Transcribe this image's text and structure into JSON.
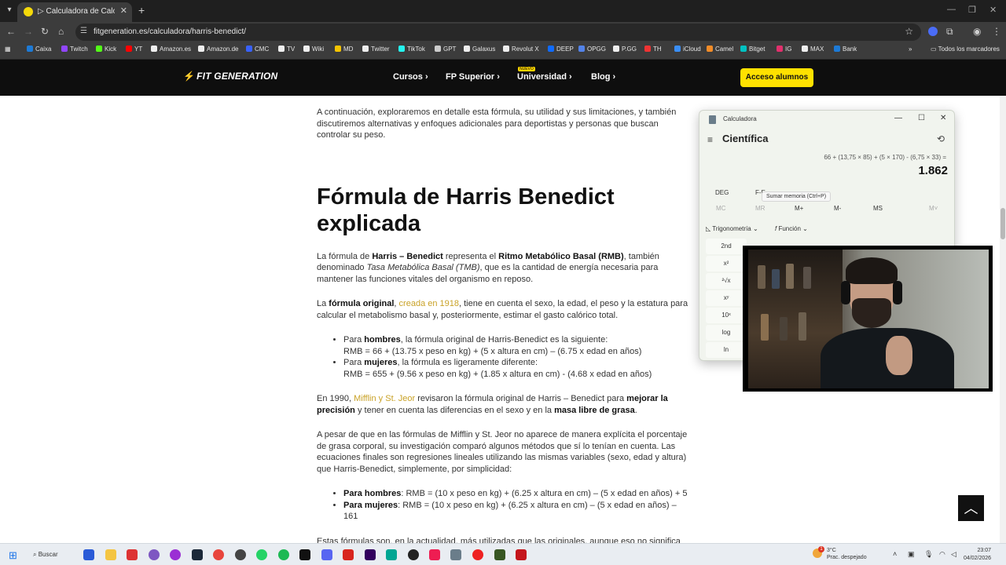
{
  "browser": {
    "tab_title": "▷ Calculadora de Calorías Harr",
    "url": "fitgeneration.es/calculadora/harris-benedict/",
    "bookmarks": [
      {
        "label": "Caixa",
        "color": "#1d7ad6"
      },
      {
        "label": "Twitch",
        "color": "#9146ff"
      },
      {
        "label": "Kick",
        "color": "#53fc18"
      },
      {
        "label": "YT",
        "color": "#ff0000"
      },
      {
        "label": "Amazon.es",
        "color": "#eeeeee"
      },
      {
        "label": "Amazon.de",
        "color": "#eeeeee"
      },
      {
        "label": "CMC",
        "color": "#3861fb"
      },
      {
        "label": "TV",
        "color": "#eeeeee"
      },
      {
        "label": "Wiki",
        "color": "#eeeeee"
      },
      {
        "label": "MD",
        "color": "#f5c400"
      },
      {
        "label": "Twitter",
        "color": "#eeeeee"
      },
      {
        "label": "TikTok",
        "color": "#25f4ee"
      },
      {
        "label": "GPT",
        "color": "#cccccc"
      },
      {
        "label": "Galaxus",
        "color": "#eeeeee"
      },
      {
        "label": "Revolut X",
        "color": "#eeeeee"
      },
      {
        "label": "DEEP",
        "color": "#0f6bff"
      },
      {
        "label": "OPGG",
        "color": "#5383e8"
      },
      {
        "label": "P.GG",
        "color": "#eeeeee"
      },
      {
        "label": "TH",
        "color": "#e33"
      },
      {
        "label": "iCloud",
        "color": "#3a8ef6"
      },
      {
        "label": "Camel",
        "color": "#f28c28"
      },
      {
        "label": "Bitget",
        "color": "#00c1c1"
      },
      {
        "label": "IG",
        "color": "#e1306c"
      },
      {
        "label": "MAX",
        "color": "#eeeeee"
      },
      {
        "label": "Bank",
        "color": "#1d7ad6"
      }
    ],
    "all_bookmarks": "Todos los marcadores"
  },
  "site": {
    "logo": "FIT GENERATION",
    "nav": [
      "Cursos",
      "FP Superior",
      "Universidad",
      "Blog"
    ],
    "nav_badge": "NUEVO",
    "cta": "Acceso alumnos"
  },
  "article": {
    "intro": "A continuación, exploraremos en detalle esta fórmula, su utilidad y sus limitaciones, y también discutiremos alternativas y enfoques adicionales para deportistas y personas que buscan controlar su peso.",
    "heading": "Fórmula de Harris Benedict explicada",
    "p1": {
      "a": "La fórmula de ",
      "b1": "Harris – Benedict",
      "c": " representa el ",
      "b2": "Ritmo Metabólico Basal (RMB)",
      "d": ", también denominado ",
      "i1": "Tasa Metabólica Basal (TMB)",
      "e": ", que es la cantidad de energía necesaria para mantener las funciones vitales del organismo en reposo."
    },
    "p2": {
      "a": "La ",
      "b1": "fórmula original",
      "c": ", ",
      "link": "creada en 1918",
      "d": ", tiene en cuenta el sexo, la edad, el peso y la estatura para calcular el metabolismo basal y, posteriormente, estimar el gasto calórico total."
    },
    "list1": [
      {
        "pre": "Para ",
        "bold": "hombres",
        "post": ", la fórmula original de Harris-Benedict es la siguiente:",
        "formula": "RMB = 66 + (13.75 x peso en kg) + (5 x altura en cm) – (6.75 x edad en años)"
      },
      {
        "pre": "Para ",
        "bold": "mujeres",
        "post": ", la fórmula es ligeramente diferente:",
        "formula": "RMB = 655 + (9.56 x peso en kg) + (1.85 x altura en cm) - (4.68 x edad en años)"
      }
    ],
    "p3": {
      "a": "En 1990, ",
      "link": "Mifflin y St. Jeor",
      "b": " revisaron la fórmula original de Harris – Benedict para ",
      "b1": "mejorar la precisión",
      "c": " y tener en cuenta las diferencias en el sexo y en la ",
      "b2": "masa libre de grasa",
      "d": "."
    },
    "p4": "A pesar de que en las fórmulas de Mifflin y St. Jeor no aparece de manera explícita el porcentaje de grasa corporal, su investigación comparó algunos métodos que sí lo tenían en cuenta. Las ecuaciones finales son regresiones lineales utilizando las mismas variables (sexo, edad y altura) que Harris-Benedict, simplemente, por simplicidad:",
    "list2": [
      {
        "bold": "Para hombres",
        "text": ": RMB = (10 x peso en kg) + (6.25 x altura en cm) – (5 x edad en años) + 5"
      },
      {
        "bold": "Para mujeres",
        "text": ": RMB = (10 x peso en kg) + (6.25 x altura en cm) – (5 x edad en años) – 161"
      }
    ],
    "p5": "Estas fórmulas son, en la actualidad, más utilizadas que las originales, aunque eso no significa"
  },
  "calculator": {
    "title": "Calculadora",
    "mode": "Científica",
    "expression": "66 + (13,75 × 85) + (5 × 170) - (6,75 × 33) =",
    "result": "1.862",
    "angle": "DEG",
    "fe": "F-E",
    "tooltip": "Sumar memoria (Ctrl+P)",
    "memory": [
      "MC",
      "MR",
      "M+",
      "M-",
      "MS",
      "M˅"
    ],
    "trig": "Trigonometría",
    "func": "Función",
    "keys": [
      "2nd",
      "x²",
      "²√x",
      "xʸ",
      "10ˣ",
      "log",
      "ln"
    ]
  },
  "taskbar": {
    "search": "Buscar",
    "weather_temp": "3°C",
    "weather_desc": "Prac. despejado",
    "weather_badge": "1",
    "time": "23:07",
    "date": "04/02/2026"
  }
}
